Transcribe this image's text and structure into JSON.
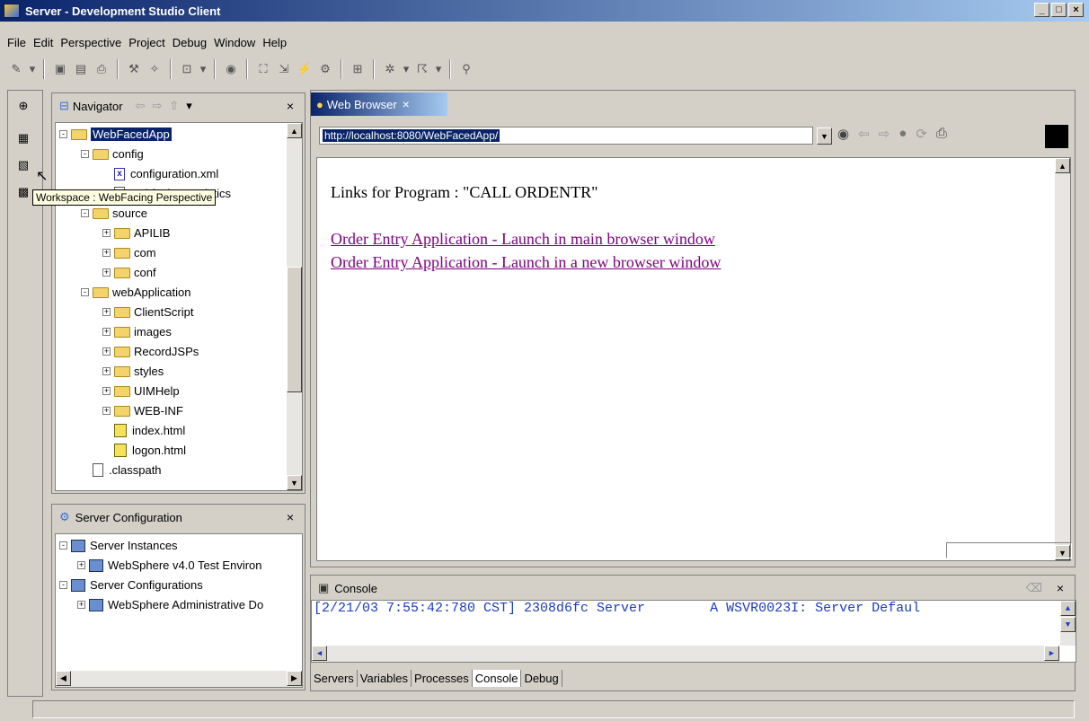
{
  "window": {
    "title": "Server - Development Studio Client"
  },
  "menu": [
    "File",
    "Edit",
    "Perspective",
    "Project",
    "Debug",
    "Window",
    "Help"
  ],
  "tooltip": "Workspace : WebFacing Perspective",
  "navigator": {
    "title": "Navigator",
    "items": [
      {
        "label": "WebFacedApp",
        "type": "project",
        "indent": 0,
        "toggle": "-",
        "selected": true
      },
      {
        "label": "config",
        "type": "folder",
        "indent": 1,
        "toggle": "-"
      },
      {
        "label": "configuration.xml",
        "type": "xml",
        "indent": 2
      },
      {
        "label": "webfacing.statistics",
        "type": "file",
        "indent": 2
      },
      {
        "label": "source",
        "type": "folder",
        "indent": 1,
        "toggle": "-"
      },
      {
        "label": "APILIB",
        "type": "folder",
        "indent": 2,
        "toggle": "+"
      },
      {
        "label": "com",
        "type": "folder",
        "indent": 2,
        "toggle": "+"
      },
      {
        "label": "conf",
        "type": "folder",
        "indent": 2,
        "toggle": "+"
      },
      {
        "label": "webApplication",
        "type": "folder",
        "indent": 1,
        "toggle": "-"
      },
      {
        "label": "ClientScript",
        "type": "folder",
        "indent": 2,
        "toggle": "+"
      },
      {
        "label": "images",
        "type": "folder",
        "indent": 2,
        "toggle": "+"
      },
      {
        "label": "RecordJSPs",
        "type": "folder",
        "indent": 2,
        "toggle": "+"
      },
      {
        "label": "styles",
        "type": "folder",
        "indent": 2,
        "toggle": "+"
      },
      {
        "label": "UIMHelp",
        "type": "folder",
        "indent": 2,
        "toggle": "+"
      },
      {
        "label": "WEB-INF",
        "type": "folder",
        "indent": 2,
        "toggle": "+"
      },
      {
        "label": "index.html",
        "type": "html",
        "indent": 2
      },
      {
        "label": "logon.html",
        "type": "html",
        "indent": 2
      },
      {
        "label": ".classpath",
        "type": "file",
        "indent": 1
      }
    ]
  },
  "server_config": {
    "title": "Server Configuration",
    "items": [
      {
        "label": "Server Instances",
        "toggle": "-",
        "indent": 0
      },
      {
        "label": "WebSphere v4.0 Test Environ",
        "toggle": "+",
        "indent": 1
      },
      {
        "label": "Server Configurations",
        "toggle": "-",
        "indent": 0
      },
      {
        "label": "WebSphere Administrative Do",
        "toggle": "+",
        "indent": 1
      }
    ]
  },
  "browser": {
    "tab": "Web Browser",
    "url": "http://localhost:8080/WebFacedApp/",
    "heading": "Links for Program : \"CALL ORDENTR\"",
    "links": [
      "Order Entry Application - Launch in main browser window",
      "Order Entry Application - Launch in a new browser window"
    ]
  },
  "console": {
    "title": "Console",
    "line": "[2/21/03 7:55:42:780 CST] 2308d6fc Server        A WSVR0023I: Server Defaul"
  },
  "bottom_tabs": [
    "Servers",
    "Variables",
    "Processes",
    "Console",
    "Debug"
  ],
  "colors": {
    "titlebar": "#0a246a",
    "link": "#800080",
    "console_text": "#1a3cc0"
  }
}
